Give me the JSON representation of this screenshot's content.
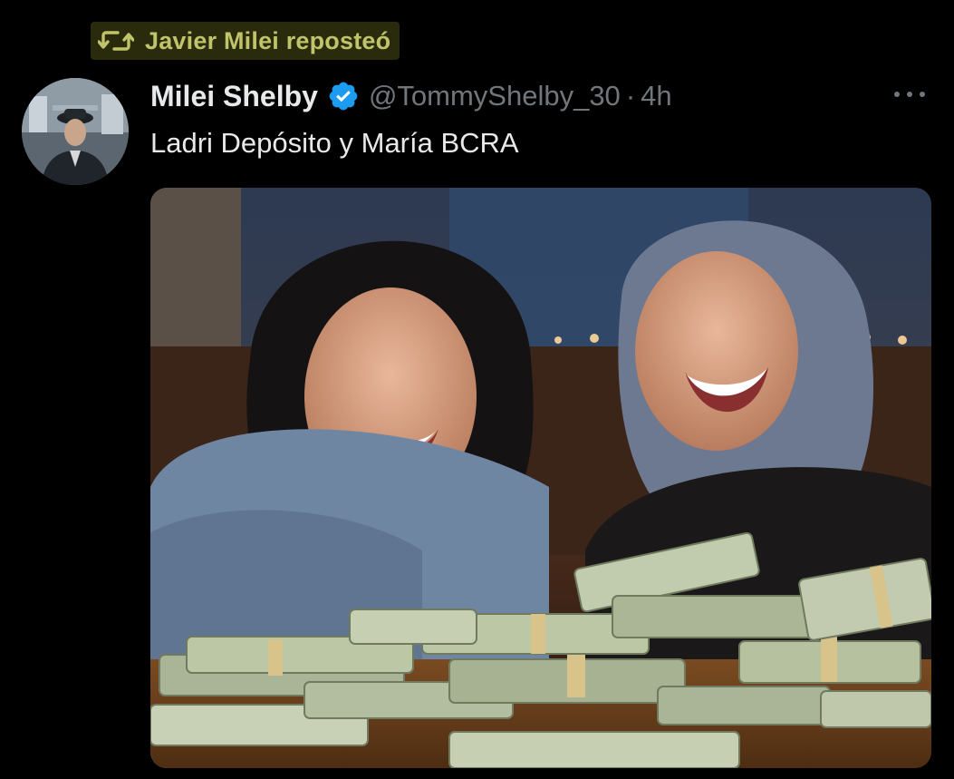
{
  "repost": {
    "icon": "repost-icon",
    "text": "Javier Milei reposteó",
    "highlight_color": "#2a2a0c",
    "text_color": "#bfc36a"
  },
  "tweet": {
    "display_name": "Milei Shelby",
    "verified_icon": "verified-badge-icon",
    "verified_color": "#1d9bf0",
    "handle": "@TommyShelby_30",
    "separator": "·",
    "time": "4h",
    "text": "Ladri Depósito y María BCRA",
    "more_icon": "more-icon",
    "media_icon": "photo"
  },
  "colors": {
    "background": "#000000",
    "primary_text": "#e7e9ea",
    "secondary_text": "#71767b"
  }
}
